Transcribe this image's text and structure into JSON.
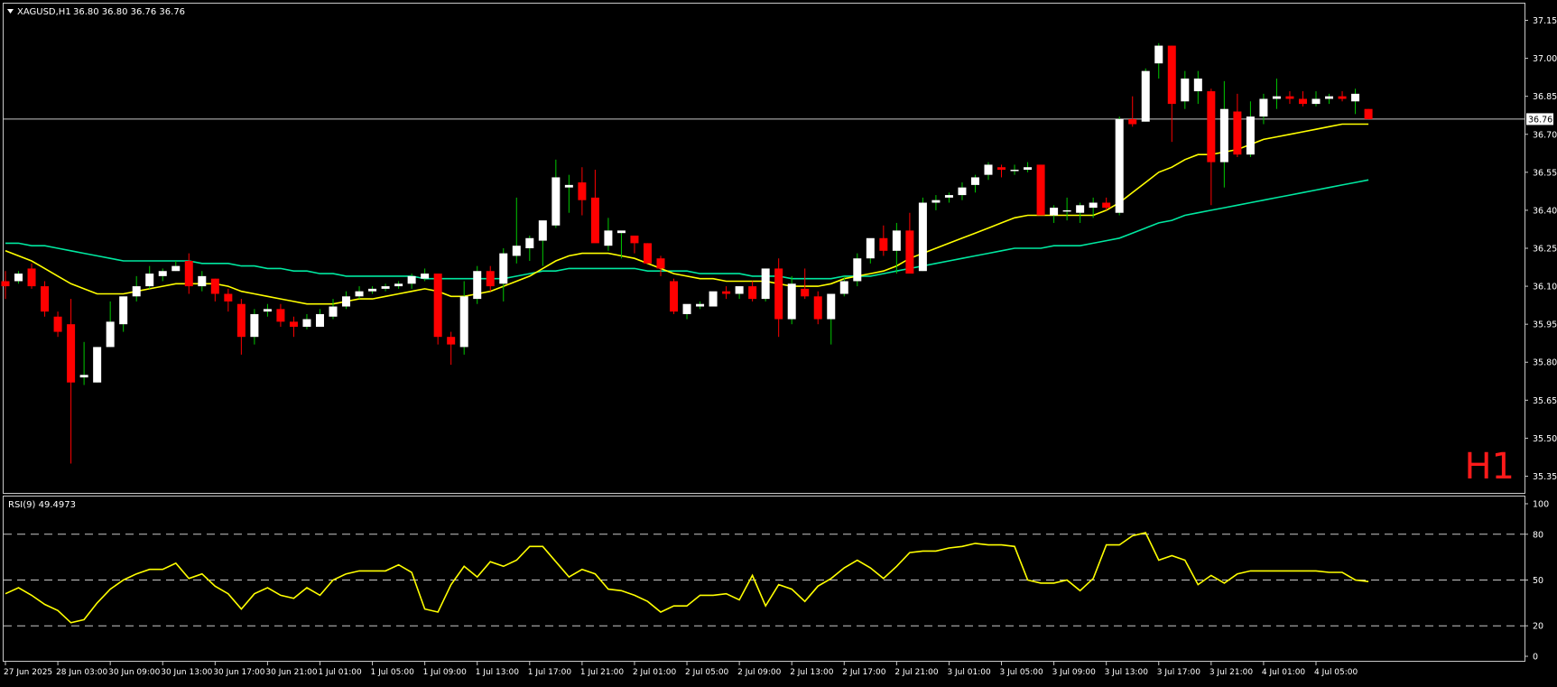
{
  "colors": {
    "background": "#000000",
    "frame": "#c8c8c8",
    "text": "#ffffff",
    "bull_candle": "#ffffff",
    "bear_candle": "#ff0000",
    "wick_up": "#00c800",
    "wick_down": "#ff0000",
    "ma_fast": "#ffff00",
    "ma_slow": "#00e8a0",
    "rsi_line": "#ffff00",
    "level_line": "#c8c8c8",
    "price_line": "#c8c8c8",
    "timeframe_label": "#ff1a1a"
  },
  "chart_data": [
    {
      "type": "candlestick",
      "symbol": "XAGUSD,H1",
      "header_values": "36.80 36.80 36.76 36.76",
      "timeframe_label": "H1",
      "current_price": "36.76",
      "grid": false,
      "ylim": [
        35.3,
        37.2
      ],
      "y_ticks": [
        "37.15",
        "37.00",
        "36.85",
        "36.70",
        "36.55",
        "36.40",
        "36.25",
        "36.10",
        "35.95",
        "35.80",
        "35.65",
        "35.50",
        "35.35"
      ],
      "x_tick_labels": [
        {
          "i": 0,
          "label": "27 Jun 2025"
        },
        {
          "i": 4,
          "label": "28 Jun 03:00"
        },
        {
          "i": 8,
          "label": "30 Jun 09:00"
        },
        {
          "i": 12,
          "label": "30 Jun 13:00"
        },
        {
          "i": 16,
          "label": "30 Jun 17:00"
        },
        {
          "i": 20,
          "label": "30 Jun 21:00"
        },
        {
          "i": 24,
          "label": "1 Jul 01:00"
        },
        {
          "i": 28,
          "label": "1 Jul 05:00"
        },
        {
          "i": 32,
          "label": "1 Jul 09:00"
        },
        {
          "i": 36,
          "label": "1 Jul 13:00"
        },
        {
          "i": 40,
          "label": "1 Jul 17:00"
        },
        {
          "i": 44,
          "label": "1 Jul 21:00"
        },
        {
          "i": 48,
          "label": "2 Jul 01:00"
        },
        {
          "i": 52,
          "label": "2 Jul 05:00"
        },
        {
          "i": 56,
          "label": "2 Jul 09:00"
        },
        {
          "i": 60,
          "label": "2 Jul 13:00"
        },
        {
          "i": 64,
          "label": "2 Jul 17:00"
        },
        {
          "i": 68,
          "label": "2 Jul 21:00"
        },
        {
          "i": 72,
          "label": "3 Jul 01:00"
        },
        {
          "i": 76,
          "label": "3 Jul 05:00"
        },
        {
          "i": 80,
          "label": "3 Jul 09:00"
        },
        {
          "i": 84,
          "label": "3 Jul 13:00"
        },
        {
          "i": 88,
          "label": "3 Jul 17:00"
        },
        {
          "i": 92,
          "label": "3 Jul 21:00"
        },
        {
          "i": 96,
          "label": "4 Jul 01:00"
        },
        {
          "i": 100,
          "label": "4 Jul 05:00"
        }
      ],
      "candles": [
        [
          36.12,
          36.16,
          36.05,
          36.1
        ],
        [
          36.12,
          36.16,
          36.11,
          36.15
        ],
        [
          36.17,
          36.19,
          36.09,
          36.1
        ],
        [
          36.1,
          36.12,
          35.98,
          36.0
        ],
        [
          35.98,
          36.0,
          35.9,
          35.92
        ],
        [
          35.95,
          36.05,
          35.4,
          35.72
        ],
        [
          35.74,
          35.88,
          35.71,
          35.75
        ],
        [
          35.72,
          35.86,
          35.72,
          35.86
        ],
        [
          35.86,
          36.04,
          35.86,
          35.96
        ],
        [
          35.95,
          36.06,
          35.92,
          36.06
        ],
        [
          36.06,
          36.14,
          36.04,
          36.1
        ],
        [
          36.1,
          36.18,
          36.09,
          36.15
        ],
        [
          36.14,
          36.17,
          36.12,
          36.16
        ],
        [
          36.16,
          36.2,
          36.16,
          36.18
        ],
        [
          36.2,
          36.23,
          36.07,
          36.1
        ],
        [
          36.1,
          36.16,
          36.08,
          36.14
        ],
        [
          36.13,
          36.13,
          36.04,
          36.07
        ],
        [
          36.07,
          36.09,
          36.0,
          36.04
        ],
        [
          36.03,
          36.05,
          35.83,
          35.9
        ],
        [
          35.9,
          36.01,
          35.87,
          35.99
        ],
        [
          36.0,
          36.03,
          35.98,
          36.01
        ],
        [
          36.01,
          36.03,
          35.94,
          35.96
        ],
        [
          35.96,
          35.98,
          35.9,
          35.94
        ],
        [
          35.94,
          35.99,
          35.93,
          35.97
        ],
        [
          35.94,
          36.01,
          35.94,
          35.99
        ],
        [
          35.98,
          36.05,
          35.97,
          36.02
        ],
        [
          36.02,
          36.08,
          36.01,
          36.06
        ],
        [
          36.06,
          36.1,
          36.05,
          36.08
        ],
        [
          36.08,
          36.1,
          36.07,
          36.09
        ],
        [
          36.09,
          36.11,
          36.08,
          36.1
        ],
        [
          36.1,
          36.12,
          36.09,
          36.11
        ],
        [
          36.11,
          36.15,
          36.09,
          36.14
        ],
        [
          36.13,
          36.17,
          36.12,
          36.15
        ],
        [
          36.15,
          36.15,
          35.87,
          35.9
        ],
        [
          35.9,
          35.92,
          35.79,
          35.87
        ],
        [
          35.86,
          36.12,
          35.83,
          36.06
        ],
        [
          36.05,
          36.18,
          36.03,
          36.16
        ],
        [
          36.16,
          36.18,
          36.08,
          36.1
        ],
        [
          36.11,
          36.25,
          36.04,
          36.23
        ],
        [
          36.22,
          36.45,
          36.19,
          36.26
        ],
        [
          36.25,
          36.3,
          36.2,
          36.29
        ],
        [
          36.28,
          36.35,
          36.18,
          36.36
        ],
        [
          36.34,
          36.6,
          36.33,
          36.53
        ],
        [
          36.49,
          36.54,
          36.39,
          36.5
        ],
        [
          36.51,
          36.57,
          36.38,
          36.44
        ],
        [
          36.45,
          36.56,
          36.28,
          36.27
        ],
        [
          36.26,
          36.37,
          36.24,
          36.32
        ],
        [
          36.31,
          36.31,
          36.21,
          36.32
        ],
        [
          36.3,
          36.3,
          36.23,
          36.27
        ],
        [
          36.27,
          36.27,
          36.2,
          36.19
        ],
        [
          36.21,
          36.22,
          36.14,
          36.17
        ],
        [
          36.12,
          36.13,
          35.99,
          36.0
        ],
        [
          35.99,
          36.01,
          35.97,
          36.03
        ],
        [
          36.02,
          36.04,
          36.01,
          36.03
        ],
        [
          36.02,
          36.07,
          36.02,
          36.08
        ],
        [
          36.08,
          36.1,
          36.05,
          36.07
        ],
        [
          36.07,
          36.1,
          36.05,
          36.1
        ],
        [
          36.1,
          36.12,
          36.04,
          36.05
        ],
        [
          36.05,
          36.17,
          36.04,
          36.17
        ],
        [
          36.17,
          36.21,
          35.9,
          35.97
        ],
        [
          35.97,
          36.14,
          35.95,
          36.11
        ],
        [
          36.09,
          36.17,
          36.05,
          36.06
        ],
        [
          36.06,
          36.08,
          35.95,
          35.97
        ],
        [
          35.97,
          36.07,
          35.87,
          36.07
        ],
        [
          36.07,
          36.14,
          36.06,
          36.12
        ],
        [
          36.12,
          36.23,
          36.1,
          36.21
        ],
        [
          36.21,
          36.28,
          36.19,
          36.29
        ],
        [
          36.29,
          36.34,
          36.22,
          36.24
        ],
        [
          36.24,
          36.35,
          36.15,
          36.32
        ],
        [
          36.32,
          36.39,
          36.17,
          36.15
        ],
        [
          36.16,
          36.45,
          36.16,
          36.43
        ],
        [
          36.43,
          36.46,
          36.4,
          36.44
        ],
        [
          36.45,
          36.47,
          36.43,
          36.46
        ],
        [
          36.46,
          36.51,
          36.44,
          36.49
        ],
        [
          36.5,
          36.54,
          36.47,
          36.53
        ],
        [
          36.54,
          36.59,
          36.52,
          36.58
        ],
        [
          36.57,
          36.58,
          36.53,
          36.56
        ],
        [
          36.56,
          36.58,
          36.54,
          36.56
        ],
        [
          36.56,
          36.59,
          36.55,
          36.57
        ],
        [
          36.58,
          36.58,
          36.38,
          36.38
        ],
        [
          36.38,
          36.42,
          36.35,
          36.41
        ],
        [
          36.4,
          36.45,
          36.36,
          36.4
        ],
        [
          36.39,
          36.43,
          36.35,
          36.42
        ],
        [
          36.41,
          36.45,
          36.37,
          36.43
        ],
        [
          36.43,
          36.45,
          36.4,
          36.41
        ],
        [
          36.39,
          36.77,
          36.38,
          36.76
        ],
        [
          36.76,
          36.85,
          36.73,
          36.74
        ],
        [
          36.75,
          36.96,
          36.75,
          36.95
        ],
        [
          36.98,
          37.06,
          36.92,
          37.05
        ],
        [
          37.05,
          37.05,
          36.67,
          36.82
        ],
        [
          36.83,
          36.95,
          36.8,
          36.92
        ],
        [
          36.87,
          36.95,
          36.82,
          36.92
        ],
        [
          36.87,
          36.88,
          36.42,
          36.59
        ],
        [
          36.59,
          36.91,
          36.49,
          36.8
        ],
        [
          36.79,
          36.86,
          36.61,
          36.62
        ],
        [
          36.62,
          36.83,
          36.61,
          36.77
        ],
        [
          36.77,
          36.86,
          36.74,
          36.84
        ],
        [
          36.84,
          36.92,
          36.8,
          36.85
        ],
        [
          36.85,
          36.87,
          36.82,
          36.84
        ],
        [
          36.84,
          36.87,
          36.81,
          36.82
        ],
        [
          36.82,
          36.87,
          36.81,
          36.84
        ],
        [
          36.84,
          36.86,
          36.82,
          36.85
        ],
        [
          36.85,
          36.87,
          36.83,
          36.84
        ],
        [
          36.83,
          36.88,
          36.78,
          36.86
        ],
        [
          36.8,
          36.8,
          36.76,
          36.76
        ]
      ],
      "ma_fast": [
        36.24,
        36.22,
        36.2,
        36.17,
        36.14,
        36.11,
        36.09,
        36.07,
        36.07,
        36.07,
        36.08,
        36.09,
        36.1,
        36.11,
        36.11,
        36.11,
        36.11,
        36.1,
        36.08,
        36.07,
        36.06,
        36.05,
        36.04,
        36.03,
        36.03,
        36.03,
        36.04,
        36.05,
        36.05,
        36.06,
        36.07,
        36.08,
        36.09,
        36.08,
        36.06,
        36.06,
        36.07,
        36.08,
        36.1,
        36.12,
        36.14,
        36.17,
        36.2,
        36.22,
        36.23,
        36.23,
        36.23,
        36.22,
        36.21,
        36.19,
        36.17,
        36.15,
        36.14,
        36.13,
        36.13,
        36.12,
        36.12,
        36.12,
        36.12,
        36.11,
        36.1,
        36.1,
        36.1,
        36.11,
        36.13,
        36.14,
        36.15,
        36.16,
        36.18,
        36.21,
        36.23,
        36.25,
        36.27,
        36.29,
        36.31,
        36.33,
        36.35,
        36.37,
        36.38,
        36.38,
        36.38,
        36.38,
        36.38,
        36.38,
        36.4,
        36.43,
        36.47,
        36.51,
        36.55,
        36.57,
        36.6,
        36.62,
        36.62,
        36.63,
        36.64,
        36.66,
        36.68,
        36.69,
        36.7,
        36.71,
        36.72,
        36.73,
        36.74,
        36.74,
        36.74
      ],
      "ma_slow": [
        36.27,
        36.27,
        36.26,
        36.26,
        36.25,
        36.24,
        36.23,
        36.22,
        36.21,
        36.2,
        36.2,
        36.2,
        36.2,
        36.2,
        36.2,
        36.19,
        36.19,
        36.19,
        36.18,
        36.18,
        36.17,
        36.17,
        36.16,
        36.16,
        36.15,
        36.15,
        36.14,
        36.14,
        36.14,
        36.14,
        36.14,
        36.14,
        36.13,
        36.13,
        36.13,
        36.13,
        36.13,
        36.13,
        36.13,
        36.14,
        36.15,
        36.16,
        36.16,
        36.17,
        36.17,
        36.17,
        36.17,
        36.17,
        36.17,
        36.16,
        36.16,
        36.16,
        36.16,
        36.15,
        36.15,
        36.15,
        36.15,
        36.14,
        36.14,
        36.14,
        36.13,
        36.13,
        36.13,
        36.13,
        36.14,
        36.14,
        36.14,
        36.15,
        36.16,
        36.17,
        36.18,
        36.19,
        36.2,
        36.21,
        36.22,
        36.23,
        36.24,
        36.25,
        36.25,
        36.25,
        36.26,
        36.26,
        36.26,
        36.27,
        36.28,
        36.29,
        36.31,
        36.33,
        36.35,
        36.36,
        36.38,
        36.39,
        36.4,
        36.41,
        36.42,
        36.43,
        36.44,
        36.45,
        36.46,
        36.47,
        36.48,
        36.49,
        36.5,
        36.51,
        36.52
      ]
    },
    {
      "type": "line",
      "label": "RSI(9) 49.4973",
      "ylim": [
        0,
        100
      ],
      "y_ticks": [
        "100",
        "80",
        "50",
        "20",
        "0"
      ],
      "levels": [
        80,
        50,
        20
      ],
      "values": [
        41,
        45,
        40,
        34,
        30,
        22,
        24,
        35,
        44,
        50,
        54,
        57,
        57,
        61,
        51,
        54,
        46,
        41,
        31,
        41,
        45,
        40,
        38,
        45,
        40,
        50,
        54,
        56,
        56,
        56,
        60,
        55,
        31,
        29,
        47,
        59,
        52,
        62,
        59,
        63,
        72,
        72,
        62,
        52,
        57,
        54,
        44,
        43,
        40,
        36,
        29,
        33,
        33,
        40,
        40,
        41,
        37,
        53,
        33,
        47,
        44,
        36,
        46,
        51,
        58,
        63,
        58,
        51,
        59,
        68,
        69,
        69,
        71,
        72,
        74,
        73,
        73,
        72,
        50,
        48,
        48,
        50,
        43,
        51,
        73,
        73,
        79,
        81,
        63,
        66,
        63,
        47,
        53,
        48,
        54,
        56,
        56,
        56,
        56,
        56,
        56,
        55,
        55,
        50,
        49
      ]
    }
  ]
}
